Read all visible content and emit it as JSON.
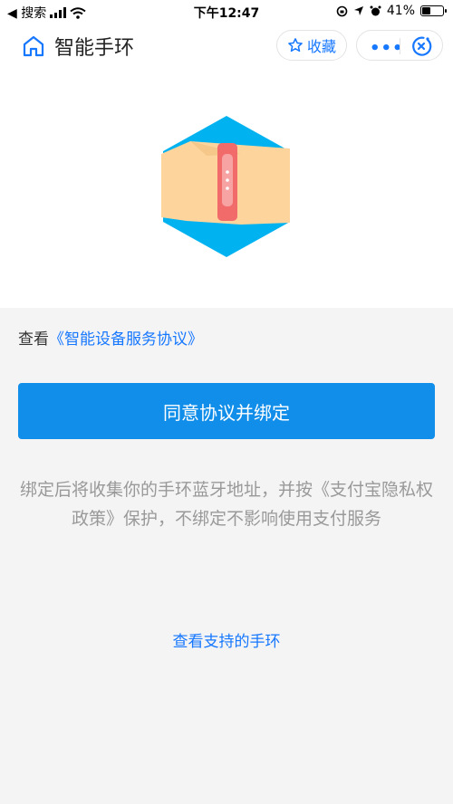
{
  "status_bar": {
    "back_label": "◀ 搜索",
    "time": "下午12:47",
    "battery_text": "41%",
    "battery_level": 0.41
  },
  "navbar": {
    "title": "智能手环",
    "favorite_label": "收藏",
    "more_label": "•••",
    "accent_color": "#1677ff"
  },
  "agreement": {
    "prefix": "查看",
    "link": "《智能设备服务协议》"
  },
  "primary_button": {
    "label": "同意协议并绑定",
    "color": "#108ee9"
  },
  "notice": {
    "text": "绑定后将收集你的手环蓝牙地址，并按《支付宝隐私权政策》保护，不绑定不影响使用支付服务"
  },
  "support_link": {
    "label": "查看支持的手环"
  }
}
